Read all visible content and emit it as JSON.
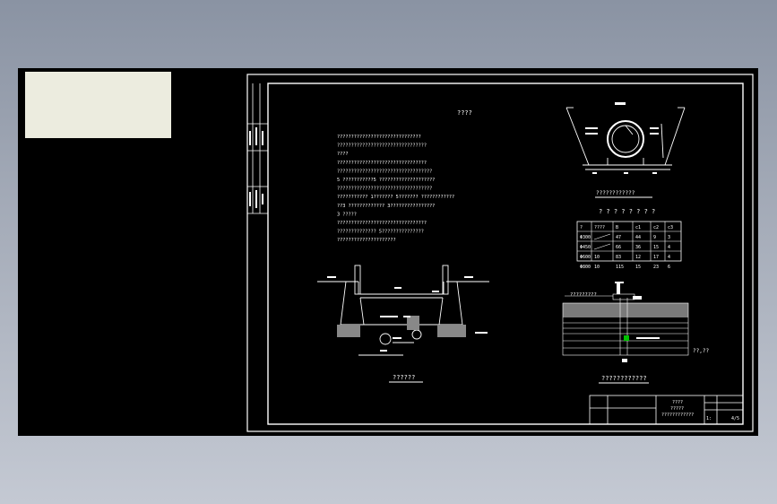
{
  "drawing": {
    "main_title": "????",
    "note_lines": [
      "??????????????????????????????",
      "????????????????????????????????",
      "????",
      "    ????????????????????????????????",
      "??????????????????????????????????",
      "5 ???????????5 ????????????????????",
      "??????????????????????????????????",
      "??????????? 1??????? 5??????? ????????????",
      "??3 ????????????? 3????????????????",
      "3 ?????",
      "    ????????????????????????????????",
      "?????????????? 5???????????????",
      "    ?????????????????????"
    ],
    "pipe_section_title": "????????????",
    "table_title": "? ? ? ? ? ? ? ?",
    "table_header": [
      "?",
      "????",
      "B",
      "c1",
      "c2",
      "c3"
    ],
    "table_rows": [
      [
        "Φ300",
        "",
        "47",
        "44",
        "9",
        "3"
      ],
      [
        "Φ450",
        "",
        "66",
        "36",
        "15",
        "4"
      ],
      [
        "Φ600",
        "10",
        "83",
        "12",
        "17",
        "4"
      ],
      [
        "Φ800",
        "10",
        "115",
        "15",
        "23",
        "6"
      ]
    ],
    "left_section_title": "??????",
    "right_section_title": "????????????",
    "leader_note": "?????????",
    "side_note": "??,??",
    "title_block": {
      "line1": "????",
      "line2": "?????",
      "line3": "????????????",
      "scale": "1:",
      "sheet": "4/5"
    }
  }
}
